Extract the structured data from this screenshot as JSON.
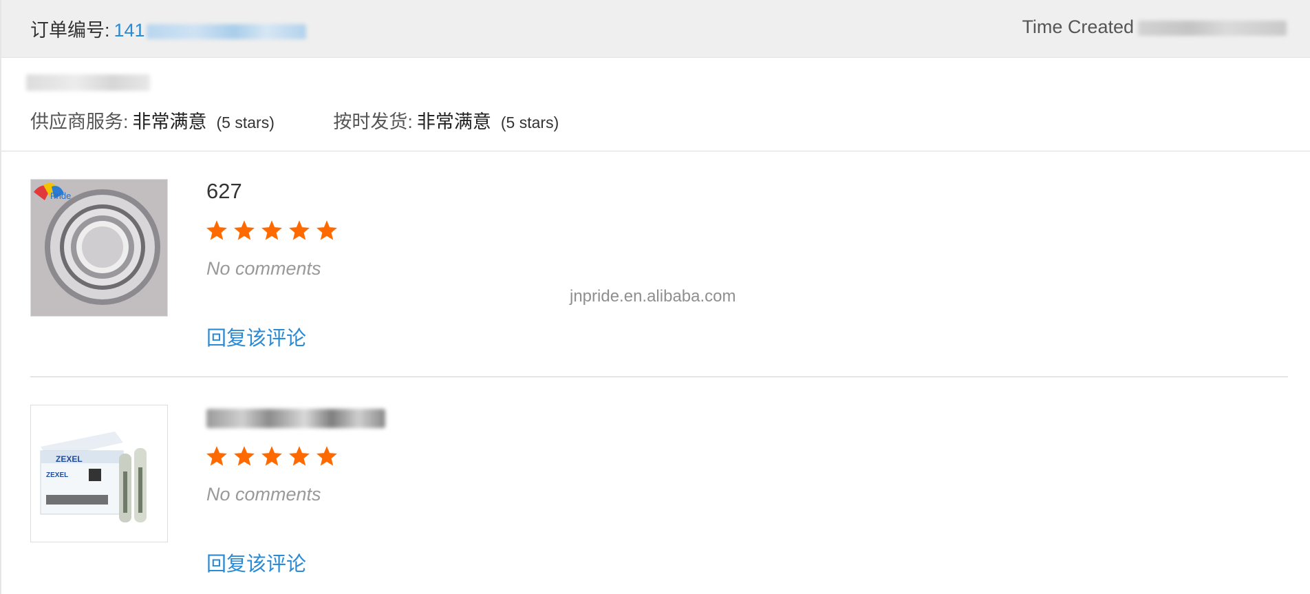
{
  "header": {
    "order_label": "订单编号:",
    "order_value": "141",
    "time_label": "Time Created"
  },
  "summary": {
    "supplier_service": {
      "label": "供应商服务:",
      "value": "非常满意",
      "stars_text": "(5 stars)"
    },
    "on_time_delivery": {
      "label": "按时发货:",
      "value": "非常满意",
      "stars_text": "(5 stars)"
    }
  },
  "reviews": [
    {
      "title": "627",
      "rating": 5,
      "comment": "No comments",
      "reply_label": "回复该评论",
      "image": "bearing-photo"
    },
    {
      "title": "",
      "rating": 5,
      "comment": "No comments",
      "reply_label": "回复该评论",
      "image": "zexel-nozzle-box-photo"
    }
  ],
  "watermark": "jnpride.en.alibaba.com",
  "colors": {
    "link": "#2a8ad4",
    "star": "#ff6a00",
    "header_bg": "#efefef"
  },
  "thumb_logo": "Pride",
  "box_brand": "ZEXEL"
}
